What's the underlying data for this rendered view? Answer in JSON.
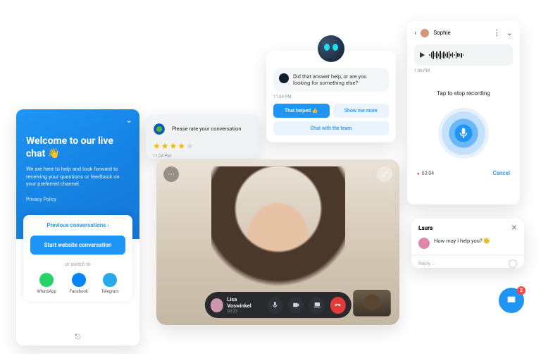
{
  "livechat": {
    "title": "Welcome to our live chat 👋",
    "subtitle": "We are here to help and look forward to receiving your questions or feedback on your preferred channel.",
    "privacy": "Privacy Policy",
    "previous": "Previous conversations",
    "start_button": "Start website conversation",
    "switch": "or switch to",
    "channels": [
      {
        "name": "WhatsApp",
        "color": "#25d366"
      },
      {
        "name": "Facebook",
        "color": "#0084ff"
      },
      {
        "name": "Telegram",
        "color": "#29a9eb"
      }
    ]
  },
  "rating": {
    "prompt": "Please rate your conversation",
    "stars": 4,
    "max_stars": 5,
    "timestamp": "11:04 PM"
  },
  "bot": {
    "message": "Did that answer help, or are you looking for something else?",
    "timestamp": "11:04 PM",
    "btn_helped": "That helped 👍",
    "btn_more": "Show me more",
    "btn_team": "Chat with the team"
  },
  "video": {
    "name": "Lisa Voswinkel",
    "duration": "00:23"
  },
  "recorder": {
    "name": "Sophie",
    "voice_timestamp": "1:06 PM",
    "prompt": "Tap to stop recording",
    "duration": "03:04",
    "cancel": "Cancel"
  },
  "laura": {
    "name": "Laura",
    "message": "How may I help you? 🙂",
    "placeholder": "Reply …"
  },
  "fab": {
    "count": "2"
  }
}
